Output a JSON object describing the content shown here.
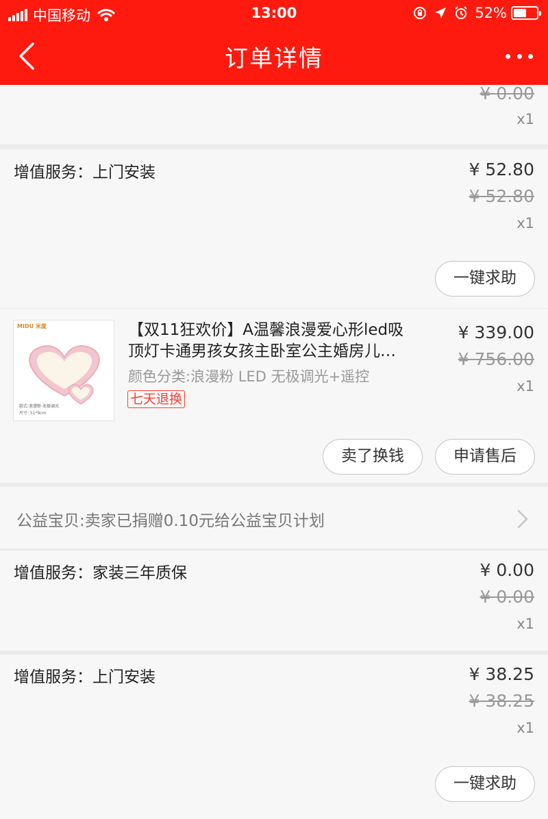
{
  "status_bar": {
    "carrier": "中国移动",
    "time": "13:00",
    "battery": "52%"
  },
  "header": {
    "title": "订单详情"
  },
  "card_top": {
    "orig_price": "¥ 0.00",
    "qty": "x1"
  },
  "service_install_1": {
    "label": "增值服务：上门安装",
    "price": "¥ 52.80",
    "orig_price": "¥ 52.80",
    "qty": "x1",
    "help_button": "一键求助"
  },
  "product": {
    "title_line1": "【双11狂欢价】A温馨浪漫爱心形led吸",
    "title_line2": "顶灯卡通男孩女孩主卧室公主婚房儿…",
    "sku": "颜色分类:浪漫粉 LED 无极调光+遥控",
    "tag": "七天退换",
    "price": "¥ 339.00",
    "orig_price": "¥ 756.00",
    "qty": "x1",
    "sell_button": "卖了换钱",
    "aftersale_button": "申请售后",
    "thumb": {
      "brand": "MIDU 米度",
      "caption1": "款式:浪漫粉-无极调光",
      "caption2": "尺寸: 51*9cm"
    }
  },
  "charity": {
    "text": "公益宝贝:卖家已捐赠0.10元给公益宝贝计划"
  },
  "service_warranty": {
    "label": "增值服务：家装三年质保",
    "price": "¥ 0.00",
    "orig_price": "¥ 0.00",
    "qty": "x1"
  },
  "service_install_2": {
    "label": "增值服务：上门安装",
    "price": "¥ 38.25",
    "orig_price": "¥ 38.25",
    "qty": "x1",
    "help_button": "一键求助"
  },
  "colors": {
    "header_red": "#ff1a0f",
    "tag_red": "#ff3b30",
    "card_bg": "#f7f7f7",
    "page_bg": "#ebebeb"
  },
  "icons": [
    "signal-icon",
    "wifi-icon",
    "orientation-lock-icon",
    "location-arrow-icon",
    "alarm-icon",
    "battery-icon",
    "back-arrow-icon",
    "more-dots-icon",
    "chevron-right-icon"
  ]
}
